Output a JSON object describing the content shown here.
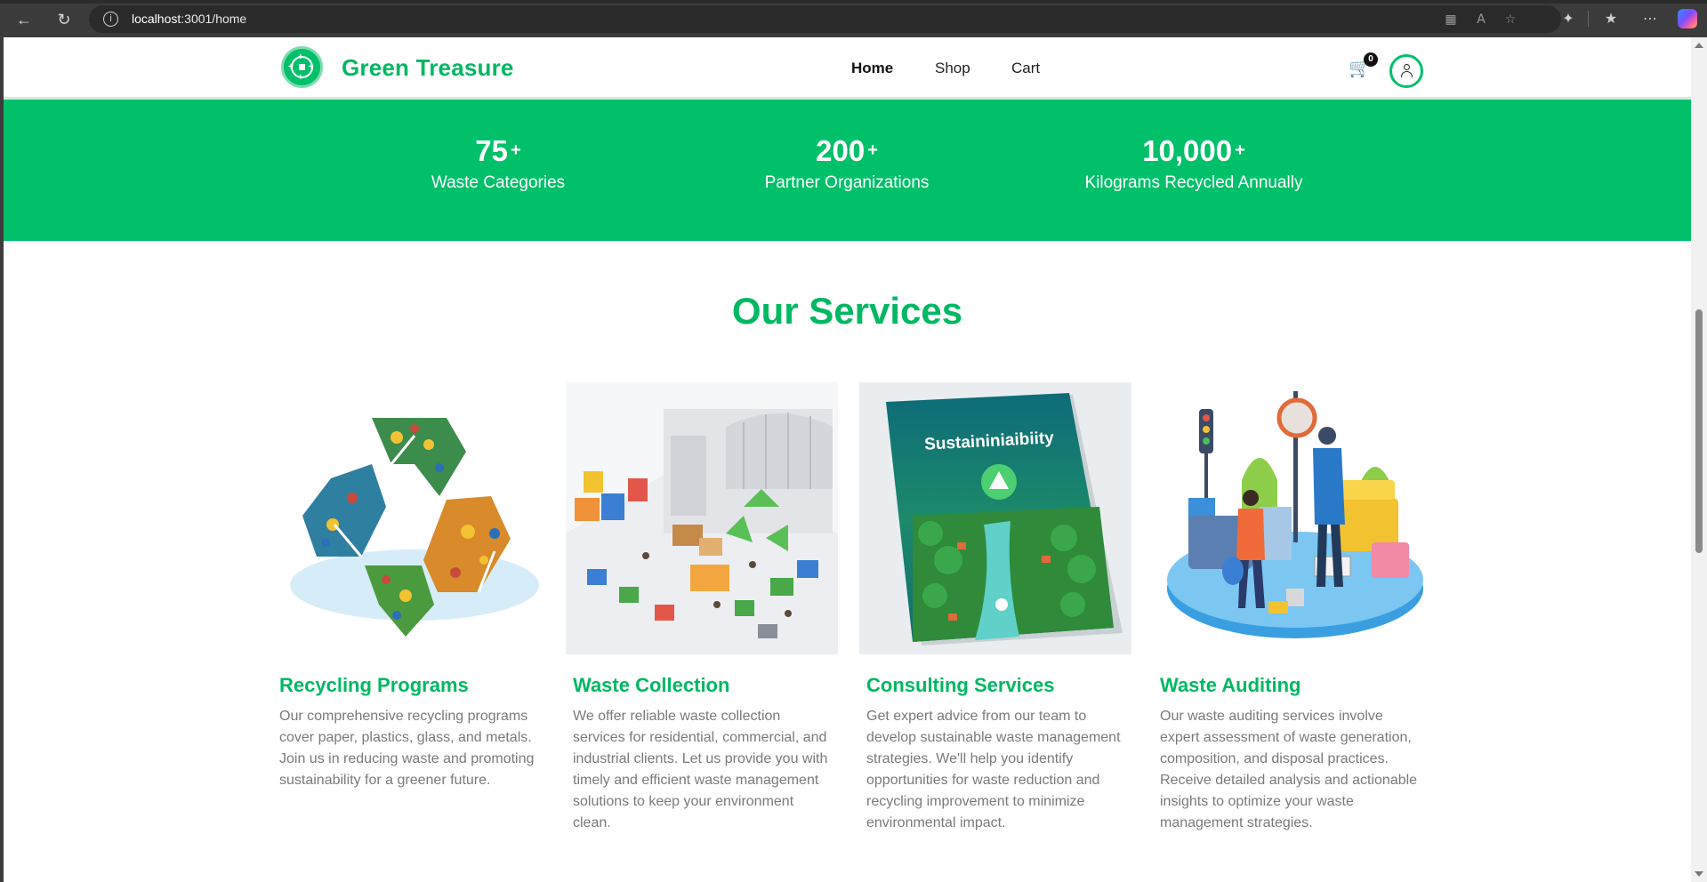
{
  "browser": {
    "url_host": "localhost",
    "url_path": ":3001/home"
  },
  "header": {
    "brand": "Green Treasure",
    "nav": [
      {
        "label": "Home",
        "active": true
      },
      {
        "label": "Shop",
        "active": false
      },
      {
        "label": "Cart",
        "active": false
      }
    ],
    "cart_count": "0"
  },
  "stats": [
    {
      "number": "75",
      "suffix": "+",
      "label": "Waste Categories"
    },
    {
      "number": "200",
      "suffix": "+",
      "label": "Partner Organizations"
    },
    {
      "number": "10,000",
      "suffix": "+",
      "label": "Kilograms Recycled Annually"
    }
  ],
  "services": {
    "title": "Our Services",
    "cards": [
      {
        "title": "Recycling Programs",
        "description": "Our comprehensive recycling programs cover paper, plastics, glass, and metals. Join us in reducing waste and promoting sustainability for a greener future."
      },
      {
        "title": "Waste Collection",
        "description": "We offer reliable waste collection services for residential, commercial, and industrial clients. Let us provide you with timely and efficient waste management solutions to keep your environment clean."
      },
      {
        "title": "Consulting Services",
        "description": "Get expert advice from our team to develop sustainable waste management strategies. We'll help you identify opportunities for waste reduction and recycling improvement to minimize environmental impact.",
        "image_text": "Sustaininiaibiity"
      },
      {
        "title": "Waste Auditing",
        "description": "Our waste auditing services involve expert assessment of waste generation, composition, and disposal practices. Receive detailed analysis and actionable insights to optimize your waste management strategies."
      }
    ]
  },
  "colors": {
    "brand_green": "#00b862",
    "band_green": "#00c06a",
    "text_gray": "#7a7a7a"
  }
}
